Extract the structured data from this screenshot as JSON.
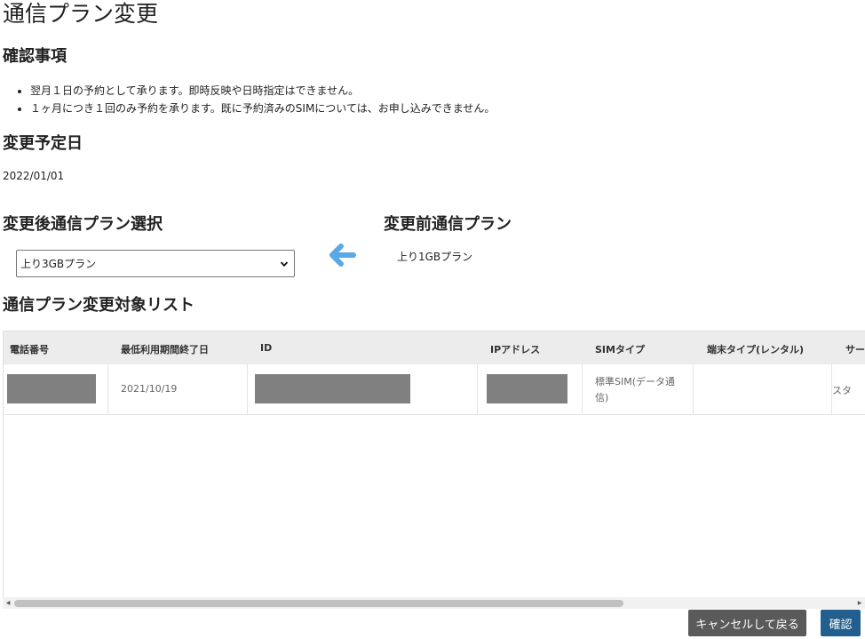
{
  "page": {
    "title": "通信プラン変更"
  },
  "confirm": {
    "heading": "確認事項",
    "items": [
      "翌月１日の予約として承ります。即時反映や日時指定はできません。",
      "１ヶ月につき１回のみ予約を承ります。既に予約済みのSIMについては、お申し込みできません。"
    ]
  },
  "schedule": {
    "heading": "変更予定日",
    "date": "2022/01/01"
  },
  "after_plan": {
    "heading": "変更後通信プラン選択",
    "selected": "上り3GBプラン"
  },
  "before_plan": {
    "heading": "変更前通信プラン",
    "value": "上り1GBプラン"
  },
  "target_list": {
    "heading": "通信プラン変更対象リスト",
    "columns": [
      "電話番号",
      "最低利用期間終了日",
      "ID",
      "IPアドレス",
      "SIMタイプ",
      "端末タイプ(レンタル)",
      "サー"
    ],
    "rows": [
      {
        "phone": "",
        "min_period_end": "2021/10/19",
        "id": "",
        "ip": "",
        "sim_type_line1": "標準SIM(データ通",
        "sim_type_line2": "信)",
        "device_type": "",
        "service": "スタ"
      }
    ]
  },
  "buttons": {
    "cancel": "キャンセルして戻る",
    "confirm": "確認"
  },
  "colors": {
    "arrow": "#5aa9e6",
    "confirm_button": "#235f8e",
    "cancel_button": "#5a5a5a",
    "header_bg": "#ececec",
    "masked": "#808080"
  },
  "icons": {
    "arrow": "arrow-left-icon",
    "select": "chevron-down-icon"
  }
}
